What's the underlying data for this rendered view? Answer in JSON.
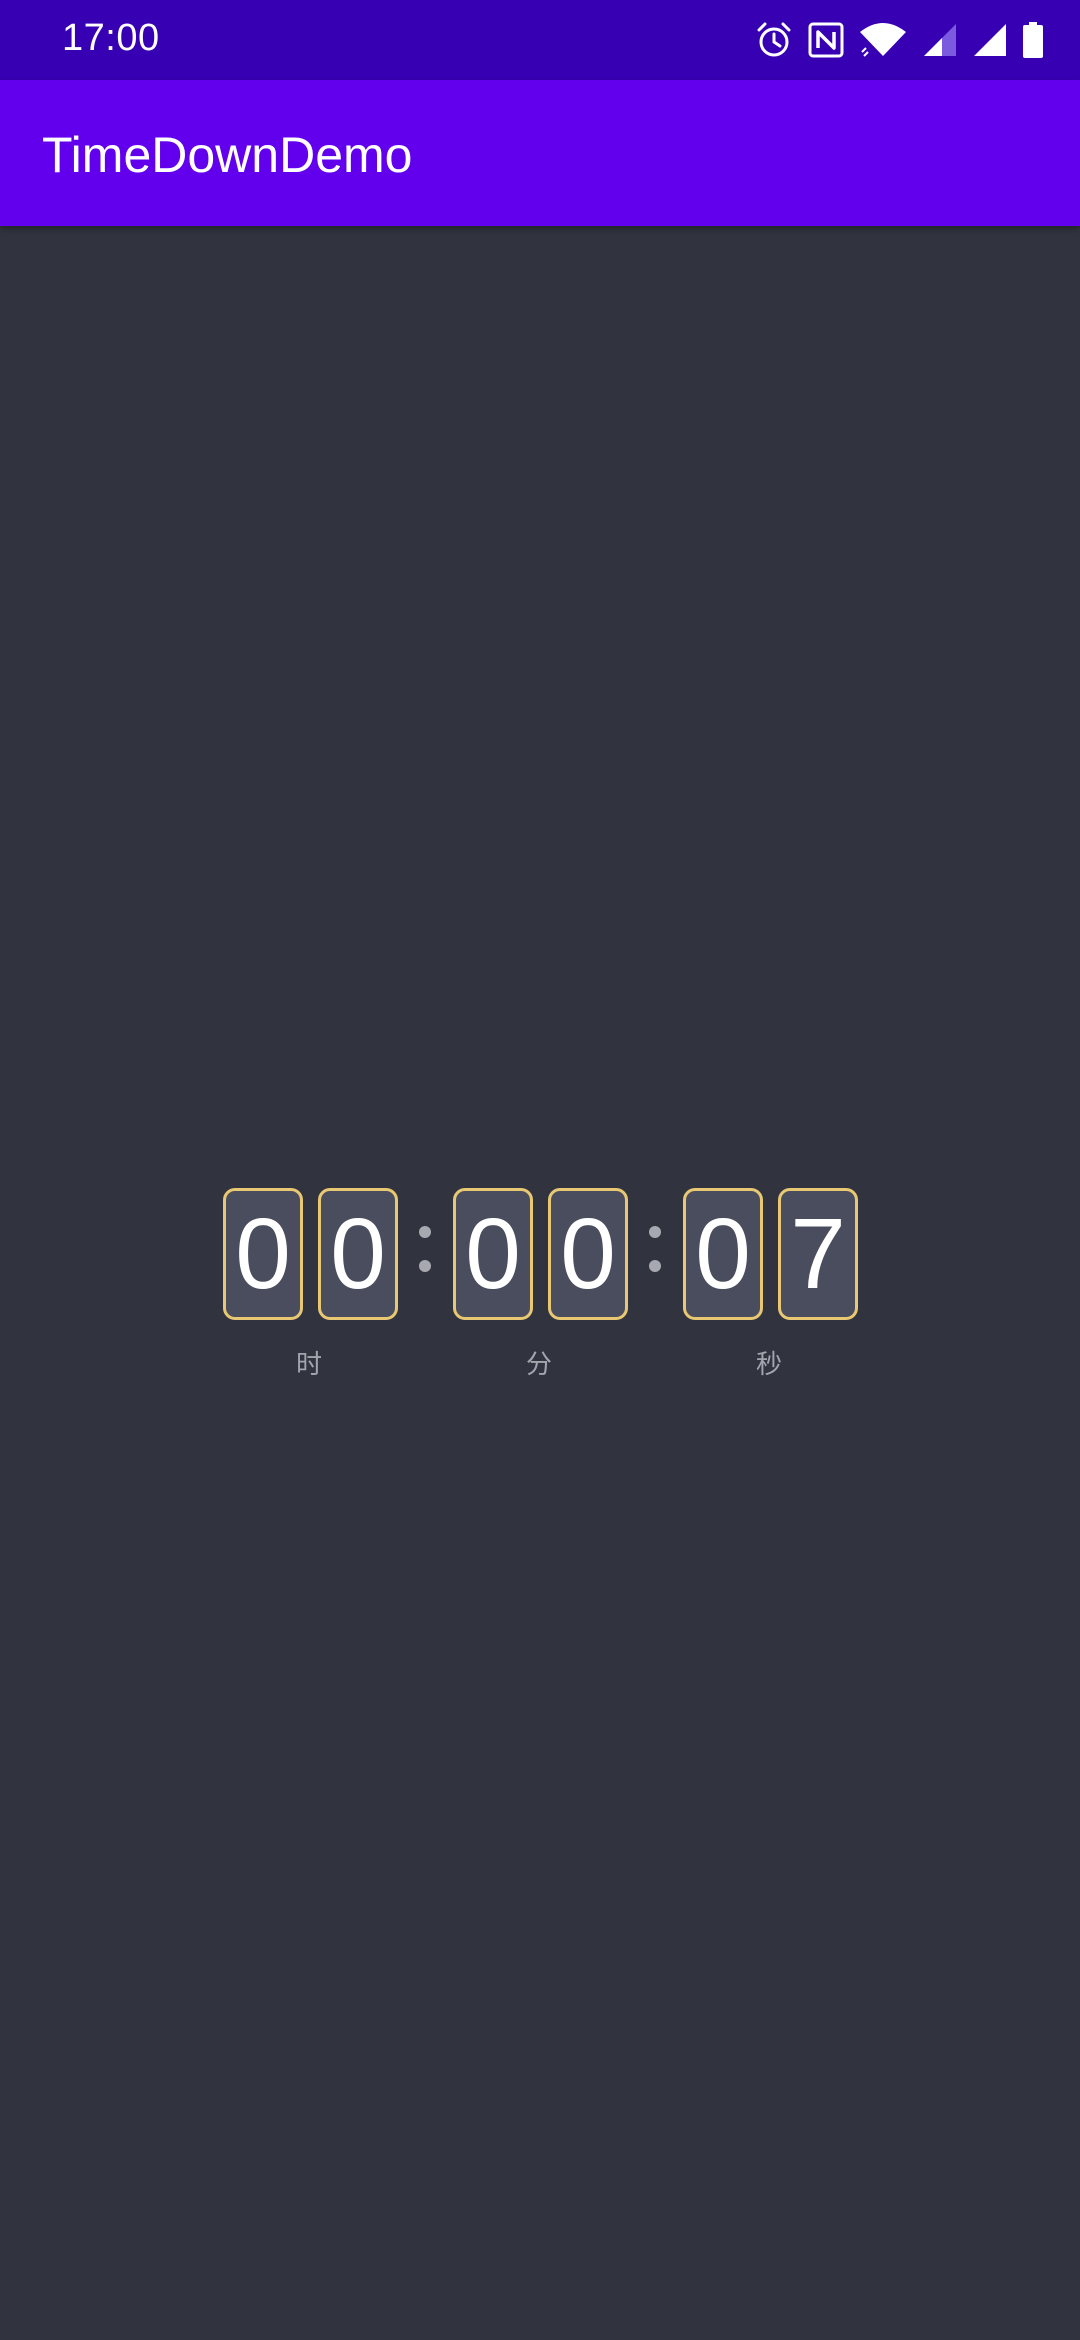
{
  "status_bar": {
    "time": "17:00",
    "icons": [
      "alarm-icon",
      "nfc-icon",
      "wifi-icon",
      "signal-icon",
      "signal-icon",
      "battery-icon"
    ]
  },
  "app_bar": {
    "title": "TimeDownDemo"
  },
  "countdown": {
    "hours": [
      "0",
      "0"
    ],
    "minutes": [
      "0",
      "0"
    ],
    "seconds": [
      "0",
      "7"
    ],
    "labels": {
      "hours": "时",
      "minutes": "分",
      "seconds": "秒"
    }
  },
  "colors": {
    "status_bar": "#3700b3",
    "app_bar": "#6200ee",
    "background": "#31343f",
    "digit_border": "#e8c872",
    "digit_fill": "#4a4d5d"
  }
}
